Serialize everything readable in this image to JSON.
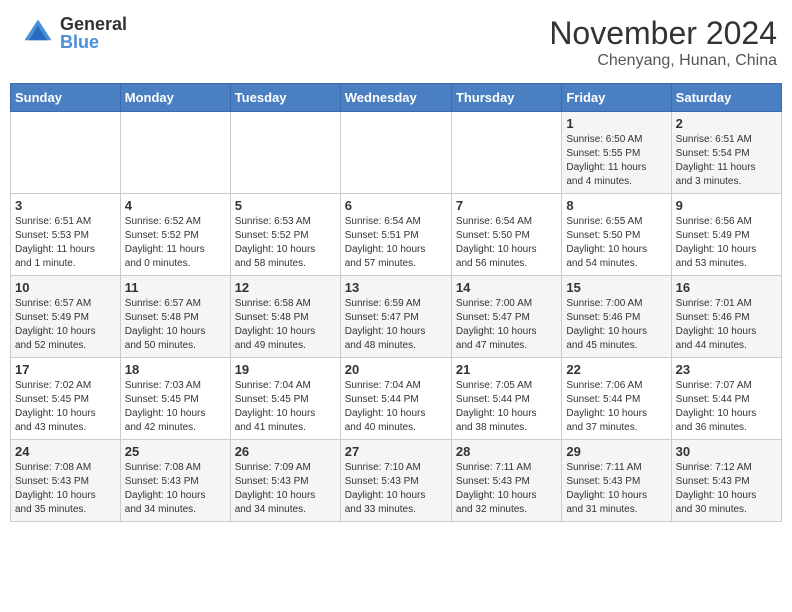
{
  "header": {
    "logo_general": "General",
    "logo_blue": "Blue",
    "month": "November 2024",
    "location": "Chenyang, Hunan, China"
  },
  "weekdays": [
    "Sunday",
    "Monday",
    "Tuesday",
    "Wednesday",
    "Thursday",
    "Friday",
    "Saturday"
  ],
  "weeks": [
    [
      {
        "day": "",
        "info": ""
      },
      {
        "day": "",
        "info": ""
      },
      {
        "day": "",
        "info": ""
      },
      {
        "day": "",
        "info": ""
      },
      {
        "day": "",
        "info": ""
      },
      {
        "day": "1",
        "info": "Sunrise: 6:50 AM\nSunset: 5:55 PM\nDaylight: 11 hours\nand 4 minutes."
      },
      {
        "day": "2",
        "info": "Sunrise: 6:51 AM\nSunset: 5:54 PM\nDaylight: 11 hours\nand 3 minutes."
      }
    ],
    [
      {
        "day": "3",
        "info": "Sunrise: 6:51 AM\nSunset: 5:53 PM\nDaylight: 11 hours\nand 1 minute."
      },
      {
        "day": "4",
        "info": "Sunrise: 6:52 AM\nSunset: 5:52 PM\nDaylight: 11 hours\nand 0 minutes."
      },
      {
        "day": "5",
        "info": "Sunrise: 6:53 AM\nSunset: 5:52 PM\nDaylight: 10 hours\nand 58 minutes."
      },
      {
        "day": "6",
        "info": "Sunrise: 6:54 AM\nSunset: 5:51 PM\nDaylight: 10 hours\nand 57 minutes."
      },
      {
        "day": "7",
        "info": "Sunrise: 6:54 AM\nSunset: 5:50 PM\nDaylight: 10 hours\nand 56 minutes."
      },
      {
        "day": "8",
        "info": "Sunrise: 6:55 AM\nSunset: 5:50 PM\nDaylight: 10 hours\nand 54 minutes."
      },
      {
        "day": "9",
        "info": "Sunrise: 6:56 AM\nSunset: 5:49 PM\nDaylight: 10 hours\nand 53 minutes."
      }
    ],
    [
      {
        "day": "10",
        "info": "Sunrise: 6:57 AM\nSunset: 5:49 PM\nDaylight: 10 hours\nand 52 minutes."
      },
      {
        "day": "11",
        "info": "Sunrise: 6:57 AM\nSunset: 5:48 PM\nDaylight: 10 hours\nand 50 minutes."
      },
      {
        "day": "12",
        "info": "Sunrise: 6:58 AM\nSunset: 5:48 PM\nDaylight: 10 hours\nand 49 minutes."
      },
      {
        "day": "13",
        "info": "Sunrise: 6:59 AM\nSunset: 5:47 PM\nDaylight: 10 hours\nand 48 minutes."
      },
      {
        "day": "14",
        "info": "Sunrise: 7:00 AM\nSunset: 5:47 PM\nDaylight: 10 hours\nand 47 minutes."
      },
      {
        "day": "15",
        "info": "Sunrise: 7:00 AM\nSunset: 5:46 PM\nDaylight: 10 hours\nand 45 minutes."
      },
      {
        "day": "16",
        "info": "Sunrise: 7:01 AM\nSunset: 5:46 PM\nDaylight: 10 hours\nand 44 minutes."
      }
    ],
    [
      {
        "day": "17",
        "info": "Sunrise: 7:02 AM\nSunset: 5:45 PM\nDaylight: 10 hours\nand 43 minutes."
      },
      {
        "day": "18",
        "info": "Sunrise: 7:03 AM\nSunset: 5:45 PM\nDaylight: 10 hours\nand 42 minutes."
      },
      {
        "day": "19",
        "info": "Sunrise: 7:04 AM\nSunset: 5:45 PM\nDaylight: 10 hours\nand 41 minutes."
      },
      {
        "day": "20",
        "info": "Sunrise: 7:04 AM\nSunset: 5:44 PM\nDaylight: 10 hours\nand 40 minutes."
      },
      {
        "day": "21",
        "info": "Sunrise: 7:05 AM\nSunset: 5:44 PM\nDaylight: 10 hours\nand 38 minutes."
      },
      {
        "day": "22",
        "info": "Sunrise: 7:06 AM\nSunset: 5:44 PM\nDaylight: 10 hours\nand 37 minutes."
      },
      {
        "day": "23",
        "info": "Sunrise: 7:07 AM\nSunset: 5:44 PM\nDaylight: 10 hours\nand 36 minutes."
      }
    ],
    [
      {
        "day": "24",
        "info": "Sunrise: 7:08 AM\nSunset: 5:43 PM\nDaylight: 10 hours\nand 35 minutes."
      },
      {
        "day": "25",
        "info": "Sunrise: 7:08 AM\nSunset: 5:43 PM\nDaylight: 10 hours\nand 34 minutes."
      },
      {
        "day": "26",
        "info": "Sunrise: 7:09 AM\nSunset: 5:43 PM\nDaylight: 10 hours\nand 34 minutes."
      },
      {
        "day": "27",
        "info": "Sunrise: 7:10 AM\nSunset: 5:43 PM\nDaylight: 10 hours\nand 33 minutes."
      },
      {
        "day": "28",
        "info": "Sunrise: 7:11 AM\nSunset: 5:43 PM\nDaylight: 10 hours\nand 32 minutes."
      },
      {
        "day": "29",
        "info": "Sunrise: 7:11 AM\nSunset: 5:43 PM\nDaylight: 10 hours\nand 31 minutes."
      },
      {
        "day": "30",
        "info": "Sunrise: 7:12 AM\nSunset: 5:43 PM\nDaylight: 10 hours\nand 30 minutes."
      }
    ]
  ]
}
